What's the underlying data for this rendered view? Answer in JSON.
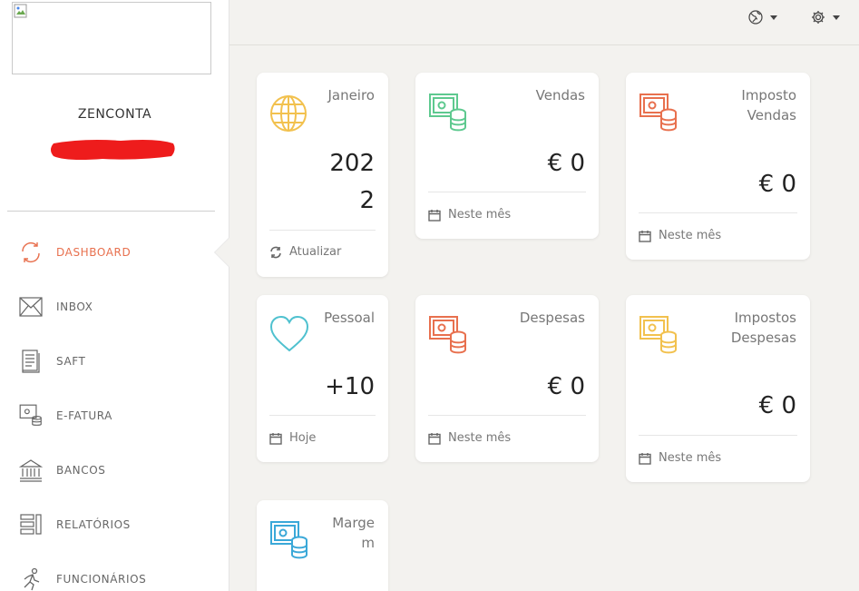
{
  "sidebar": {
    "company_name": "ZENCONTA",
    "items": [
      {
        "label": "DASHBOARD"
      },
      {
        "label": "INBOX"
      },
      {
        "label": "SAFT"
      },
      {
        "label": "E-FATURA"
      },
      {
        "label": "BANCOS"
      },
      {
        "label": "RELATÓRIOS"
      },
      {
        "label": "FUNCIONÁRIOS"
      }
    ]
  },
  "topbar": {
    "icons": [
      "globe-icon",
      "gear-icon"
    ]
  },
  "colors": {
    "accent": "#e8704e",
    "yellow": "#f2c14e",
    "green": "#5ec98f",
    "teal": "#4fc1cf",
    "cyan": "#3aa8d8"
  },
  "cards": [
    {
      "title": "Janeiro",
      "value": "202\n2",
      "footer": "Atualizar",
      "icon": "globe-icon"
    },
    {
      "title": "Vendas",
      "value": "€ 0",
      "footer": "Neste mês",
      "icon": "money-coins-icon"
    },
    {
      "title": "Imposto\nVendas",
      "value": "€ 0",
      "footer": "Neste mês",
      "icon": "money-coins-icon"
    },
    {
      "title": "Pessoal",
      "value": "+10",
      "footer": "Hoje",
      "icon": "heart-icon"
    },
    {
      "title": "Despesas",
      "value": "€ 0",
      "footer": "Neste mês",
      "icon": "money-coins-icon"
    },
    {
      "title": "Impostos\nDespesas",
      "value": "€ 0",
      "footer": "Neste mês",
      "icon": "money-coins-icon"
    },
    {
      "title": "Marge\nm",
      "value": "",
      "footer": "",
      "icon": "money-coins-icon"
    }
  ]
}
